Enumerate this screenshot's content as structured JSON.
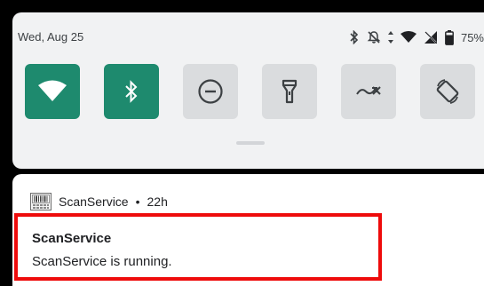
{
  "status_bar": {
    "date": "Wed, Aug 25",
    "battery_percent": "75%",
    "icons": [
      "bluetooth-icon",
      "notifications-off-icon",
      "data-arrows-icon",
      "wifi-icon",
      "no-signal-icon",
      "battery-icon"
    ]
  },
  "quick_settings": {
    "accent_color": "#1e8a6e",
    "tiles": [
      {
        "name": "wifi-tile",
        "icon": "wifi-icon",
        "state": "on"
      },
      {
        "name": "bluetooth-tile",
        "icon": "bluetooth-icon",
        "state": "on"
      },
      {
        "name": "do-not-disturb-tile",
        "icon": "minus-circle-icon",
        "state": "off"
      },
      {
        "name": "flashlight-tile",
        "icon": "flashlight-icon",
        "state": "off"
      },
      {
        "name": "data-saver-tile",
        "icon": "data-saver-icon",
        "state": "off"
      },
      {
        "name": "auto-rotate-tile",
        "icon": "rotate-icon",
        "state": "off"
      }
    ]
  },
  "notification": {
    "app_name": "ScanService",
    "separator": "•",
    "time": "22h",
    "title": "ScanService",
    "text": "ScanService is running.",
    "highlight_color": "#ee0b0b"
  }
}
